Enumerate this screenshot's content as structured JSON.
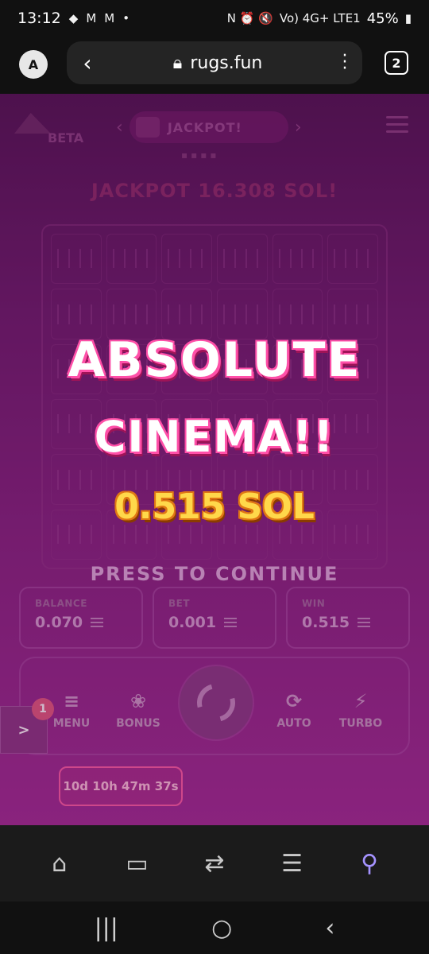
{
  "status_bar": {
    "time": "13:12",
    "carrier_icons": "N ⏰ 🔇",
    "network": "Vo) 4G+ LTE1",
    "battery": "45%"
  },
  "browser": {
    "profile_initial": "A",
    "url": "rugs.fun",
    "tab_count": "2"
  },
  "game_header": {
    "logo_badge": "BETA",
    "current_game": "JACKPOT!",
    "jackpot_banner": "JACKPOT 16.308 SOL!"
  },
  "popup": {
    "title_line1": "ABSOLUTE",
    "title_line2": "CINEMA!!",
    "amount": "0.515 SOL",
    "continue": "PRESS TO CONTINUE"
  },
  "stats": {
    "balance_label": "BALANCE",
    "balance_value": "0.070",
    "bet_label": "BET",
    "bet_value": "0.001",
    "win_label": "WIN",
    "win_value": "0.515"
  },
  "controls": {
    "menu": "MENU",
    "bonus": "BONUS",
    "auto": "AUTO",
    "turbo": "TURBO",
    "notification_count": "1",
    "side_toggle": ">"
  },
  "timer": "10d 10h 47m 37s",
  "colors": {
    "accent_pink": "#ff5fa6",
    "amount_gold": "#ffd84a",
    "active_tab": "#a593ff"
  }
}
